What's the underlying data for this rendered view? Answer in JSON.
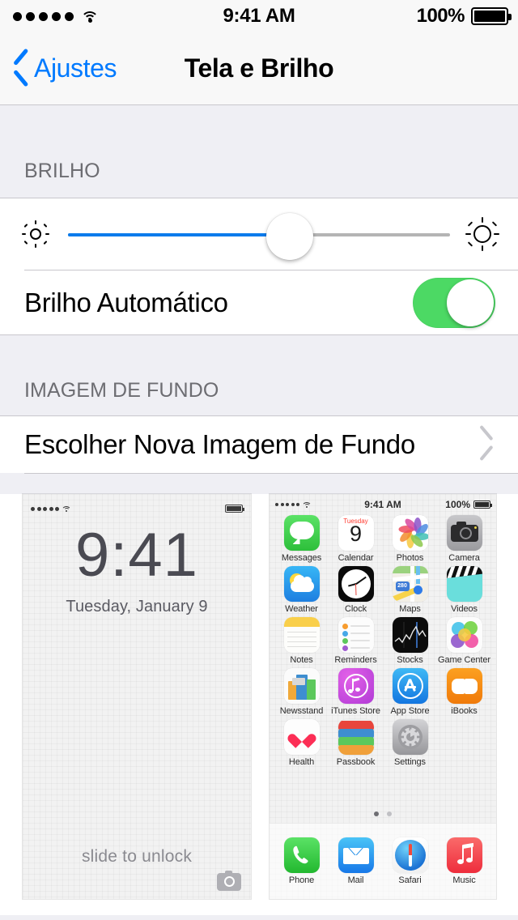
{
  "status_bar": {
    "signal_dots": 5,
    "wifi_icon": "wifi-icon",
    "time": "9:41 AM",
    "battery_percent": "100%",
    "battery_icon": "battery-full-icon"
  },
  "nav": {
    "back_icon": "chevron-left-icon",
    "back_label": "Ajustes",
    "title": "Tela e Brilho"
  },
  "brightness": {
    "header": "BRILHO",
    "slider": {
      "low_icon": "sun-small-icon",
      "high_icon": "sun-large-icon",
      "value_percent": 58
    },
    "auto": {
      "label": "Brilho Automático",
      "toggle_state": "on",
      "toggle_color": "#4CD964"
    }
  },
  "wallpaper": {
    "header": "IMAGEM DE FUNDO",
    "choose_label": "Escolher Nova Imagem de Fundo",
    "chevron_icon": "chevron-right-icon"
  },
  "lock_preview": {
    "name": "lock-screen-preview",
    "status": {
      "signal_dots": 5,
      "wifi_icon": "wifi-icon",
      "battery_icon": "battery-full-icon"
    },
    "time": "9:41",
    "date": "Tuesday, January 9",
    "slide_text": "slide to unlock",
    "camera_icon": "camera-icon"
  },
  "home_preview": {
    "name": "home-screen-preview",
    "status": {
      "signal_dots": 5,
      "wifi_icon": "wifi-icon",
      "time": "9:41 AM",
      "battery_percent": "100%"
    },
    "apps": [
      {
        "label": "Messages",
        "icon": "messages-icon"
      },
      {
        "label": "Calendar",
        "icon": "calendar-icon",
        "weekday": "Tuesday",
        "day": "9"
      },
      {
        "label": "Photos",
        "icon": "photos-icon"
      },
      {
        "label": "Camera",
        "icon": "camera-icon"
      },
      {
        "label": "Weather",
        "icon": "weather-icon"
      },
      {
        "label": "Clock",
        "icon": "clock-icon"
      },
      {
        "label": "Maps",
        "icon": "maps-icon",
        "route": "280"
      },
      {
        "label": "Videos",
        "icon": "videos-icon"
      },
      {
        "label": "Notes",
        "icon": "notes-icon"
      },
      {
        "label": "Reminders",
        "icon": "reminders-icon"
      },
      {
        "label": "Stocks",
        "icon": "stocks-icon"
      },
      {
        "label": "Game Center",
        "icon": "game-center-icon"
      },
      {
        "label": "Newsstand",
        "icon": "newsstand-icon"
      },
      {
        "label": "iTunes Store",
        "icon": "itunes-store-icon"
      },
      {
        "label": "App Store",
        "icon": "app-store-icon"
      },
      {
        "label": "iBooks",
        "icon": "ibooks-icon"
      },
      {
        "label": "Health",
        "icon": "health-icon"
      },
      {
        "label": "Passbook",
        "icon": "passbook-icon"
      },
      {
        "label": "Settings",
        "icon": "settings-icon"
      }
    ],
    "page_dots": {
      "count": 2,
      "active_index": 0
    },
    "dock": [
      {
        "label": "Phone",
        "icon": "phone-icon"
      },
      {
        "label": "Mail",
        "icon": "mail-icon"
      },
      {
        "label": "Safari",
        "icon": "safari-icon"
      },
      {
        "label": "Music",
        "icon": "music-icon"
      }
    ]
  }
}
